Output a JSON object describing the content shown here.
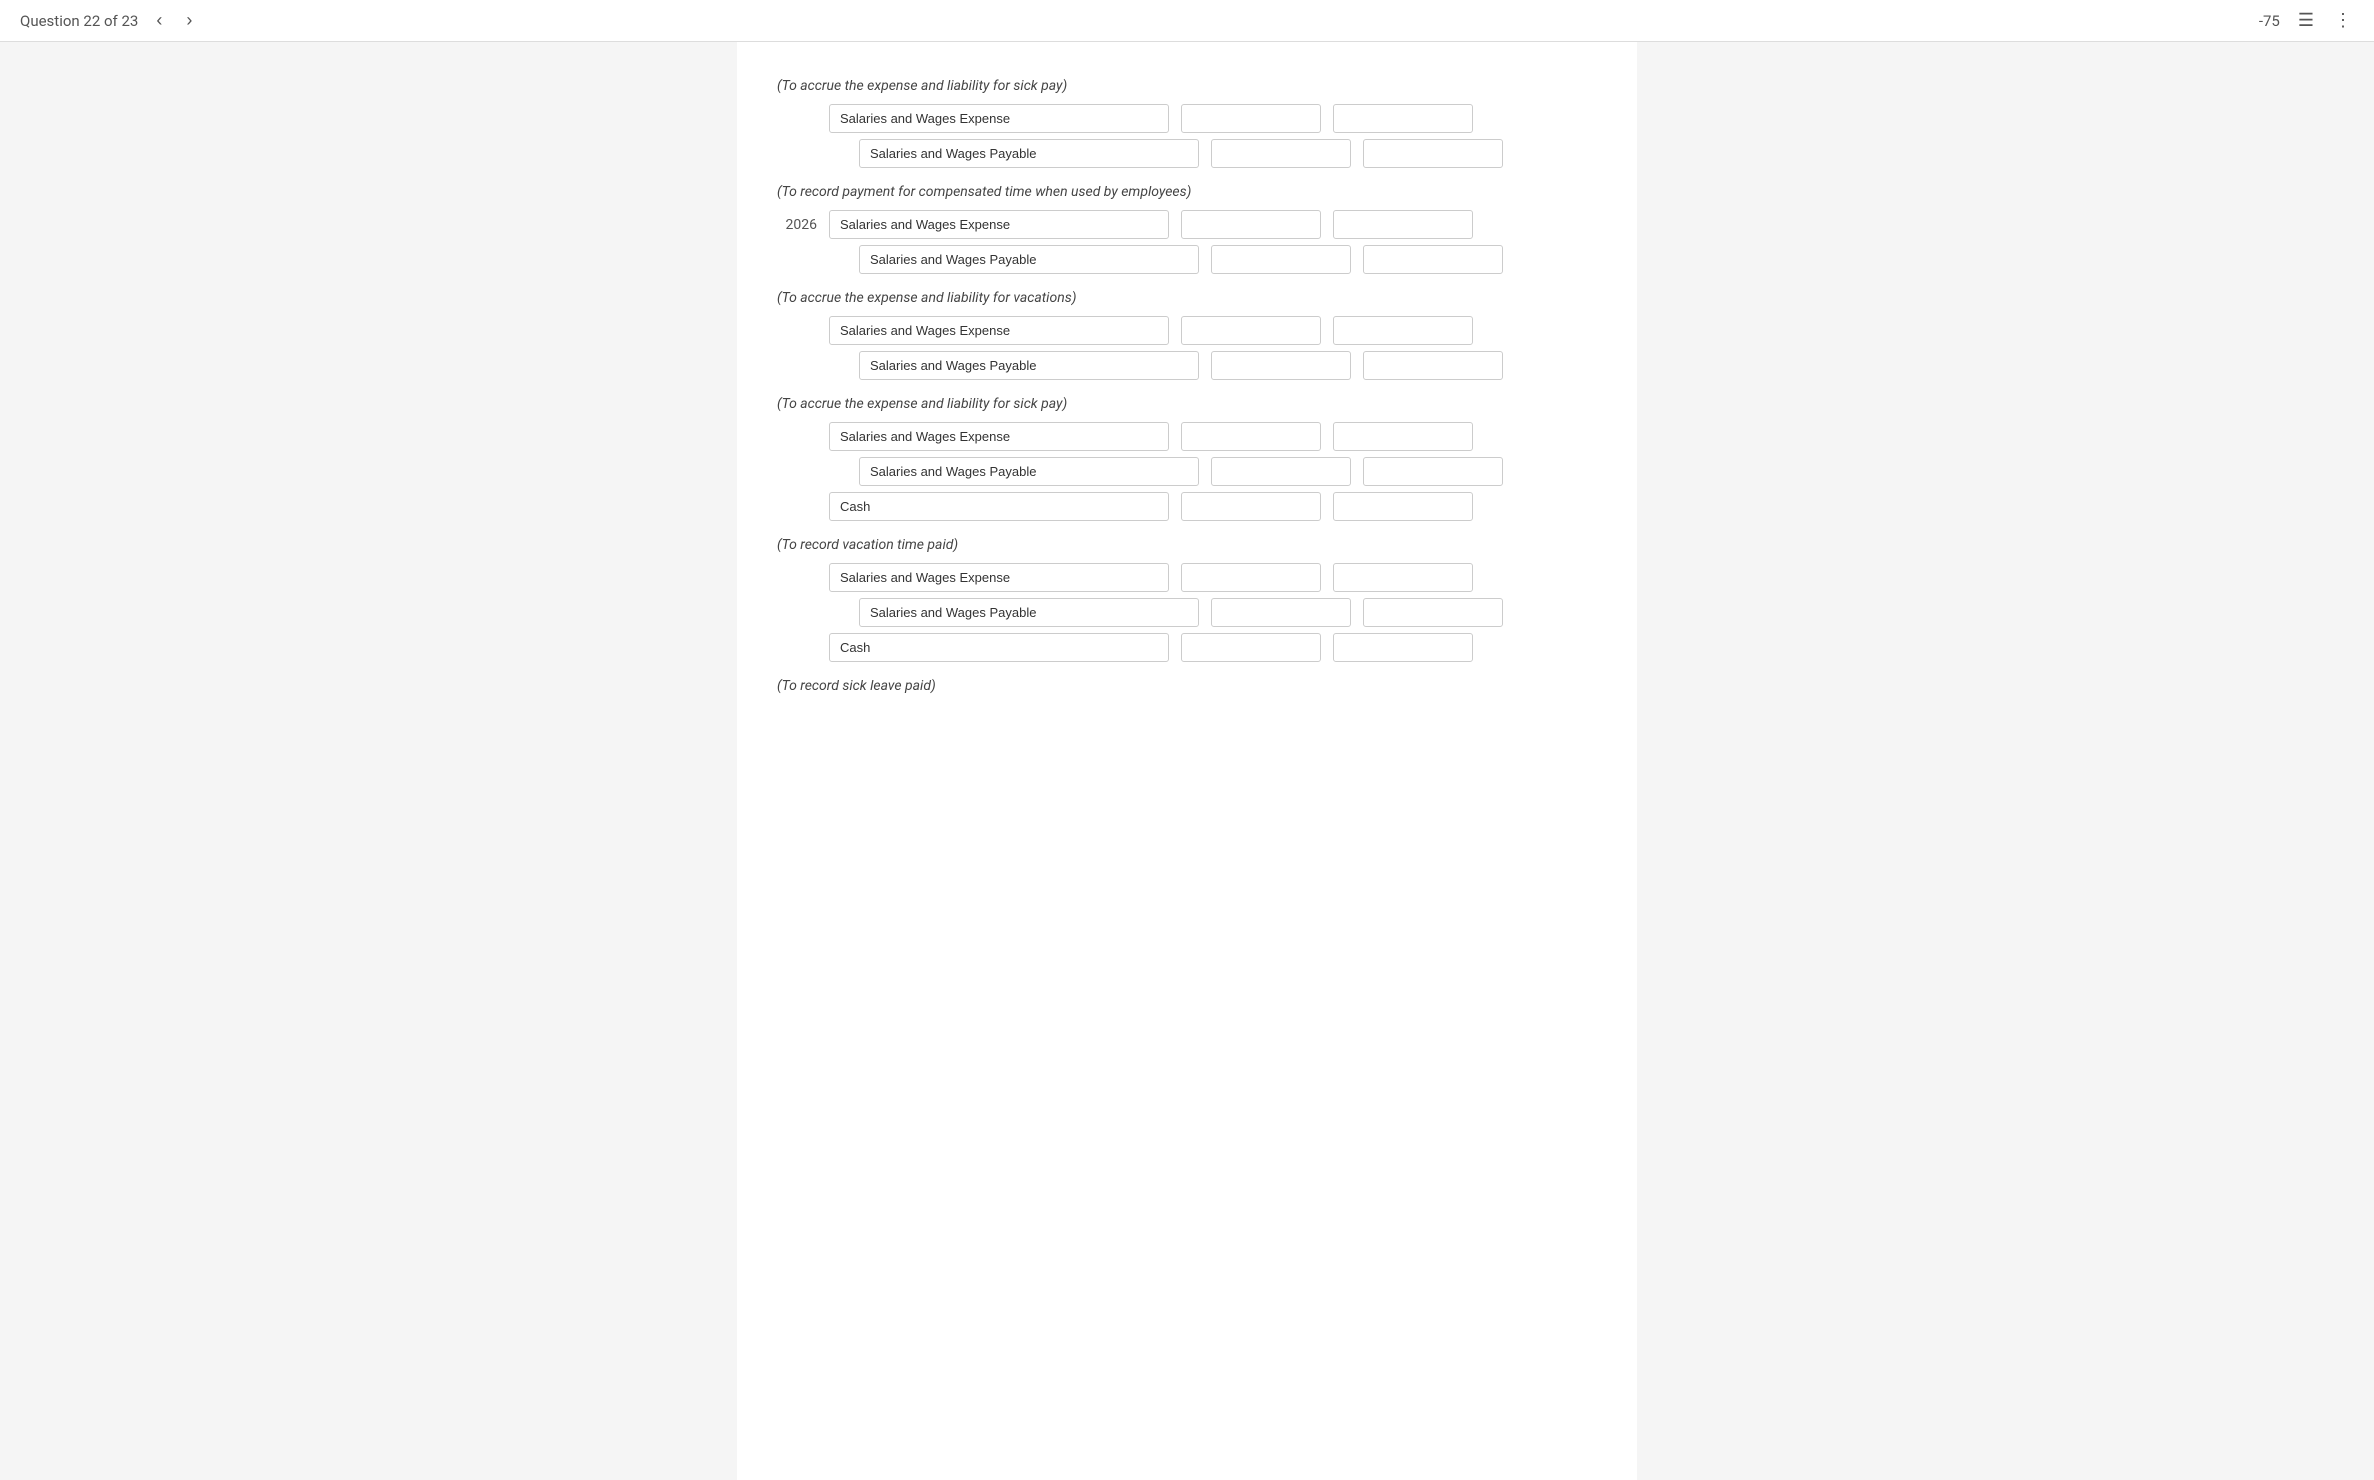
{
  "header": {
    "question_label": "Question 22 of 23",
    "prev_icon": "‹",
    "next_icon": "›",
    "score": "-75",
    "list_icon": "☰",
    "more_icon": "⋮"
  },
  "sections": [
    {
      "id": "s1",
      "description": "(To accrue the expense and liability for sick pay)",
      "year": "",
      "rows": [
        {
          "id": "r1",
          "account": "Salaries and Wages Expense",
          "debit": "",
          "credit": ""
        },
        {
          "id": "r2",
          "account": "Salaries and Wages Payable",
          "debit": "",
          "credit": "",
          "indented": true
        }
      ]
    },
    {
      "id": "s2",
      "description": "(To record payment for compensated time when used by employees)",
      "year": "2026",
      "rows": [
        {
          "id": "r3",
          "account": "Salaries and Wages Expense",
          "debit": "",
          "credit": ""
        },
        {
          "id": "r4",
          "account": "Salaries and Wages Payable",
          "debit": "",
          "credit": "",
          "indented": true
        }
      ]
    },
    {
      "id": "s3",
      "description": "(To accrue the expense and liability for vacations)",
      "year": "",
      "rows": [
        {
          "id": "r5",
          "account": "Salaries and Wages Expense",
          "debit": "",
          "credit": ""
        },
        {
          "id": "r6",
          "account": "Salaries and Wages Payable",
          "debit": "",
          "credit": "",
          "indented": true
        }
      ]
    },
    {
      "id": "s4",
      "description": "(To accrue the expense and liability for sick pay)",
      "year": "",
      "rows": [
        {
          "id": "r7",
          "account": "Salaries and Wages Expense",
          "debit": "",
          "credit": ""
        },
        {
          "id": "r8",
          "account": "Salaries and Wages Payable",
          "debit": "",
          "credit": "",
          "indented": true
        },
        {
          "id": "r9",
          "account": "Cash",
          "debit": "",
          "credit": ""
        }
      ]
    },
    {
      "id": "s5",
      "description": "(To record vacation time paid)",
      "year": "",
      "rows": [
        {
          "id": "r10",
          "account": "Salaries and Wages Expense",
          "debit": "",
          "credit": ""
        },
        {
          "id": "r11",
          "account": "Salaries and Wages Payable",
          "debit": "",
          "credit": "",
          "indented": true
        },
        {
          "id": "r12",
          "account": "Cash",
          "debit": "",
          "credit": ""
        }
      ]
    },
    {
      "id": "s6",
      "description": "(To record sick leave paid)",
      "year": "",
      "rows": []
    }
  ]
}
